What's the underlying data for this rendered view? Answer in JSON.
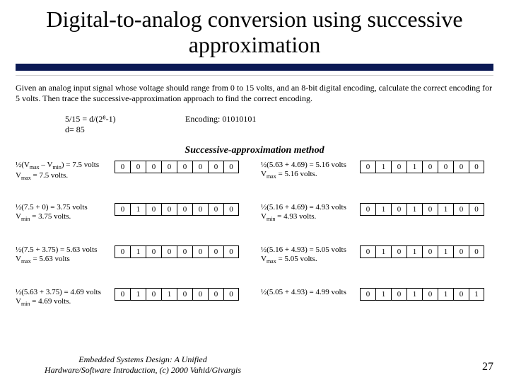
{
  "title": "Digital-to-analog conversion using successive approximation",
  "problem": "Given an analog input signal whose voltage should range from 0 to 15 volts, and an 8-bit digital encoding, calculate the correct encoding for 5 volts. Then trace the successive-approximation approach to find the correct encoding.",
  "setup": {
    "line1": "5/15 = d/(2⁸-1)",
    "line2": "d= 85",
    "encoding_label": "Encoding: 01010101"
  },
  "method_title": "Successive-approximation method",
  "left_steps": [
    {
      "l1": "½(V<max> – V<min>) = 7.5 volts",
      "l2": "V<max> = 7.5 volts.",
      "bits": [
        "0",
        "0",
        "0",
        "0",
        "0",
        "0",
        "0",
        "0"
      ]
    },
    {
      "l1": "½(7.5 + 0) = 3.75 volts",
      "l2": "V<min> = 3.75 volts.",
      "bits": [
        "0",
        "1",
        "0",
        "0",
        "0",
        "0",
        "0",
        "0"
      ]
    },
    {
      "l1": "½(7.5 + 3.75) = 5.63 volts",
      "l2": "V<max> = 5.63 volts",
      "bits": [
        "0",
        "1",
        "0",
        "0",
        "0",
        "0",
        "0",
        "0"
      ]
    },
    {
      "l1": "½(5.63 + 3.75) = 4.69 volts",
      "l2": "V<min> = 4.69 volts.",
      "bits": [
        "0",
        "1",
        "0",
        "1",
        "0",
        "0",
        "0",
        "0"
      ]
    }
  ],
  "right_steps": [
    {
      "l1": "½(5.63 + 4.69) = 5.16 volts",
      "l2": "V<max> = 5.16 volts.",
      "bits": [
        "0",
        "1",
        "0",
        "1",
        "0",
        "0",
        "0",
        "0"
      ]
    },
    {
      "l1": "½(5.16 + 4.69) = 4.93 volts",
      "l2": "V<min> = 4.93 volts.",
      "bits": [
        "0",
        "1",
        "0",
        "1",
        "0",
        "1",
        "0",
        "0"
      ]
    },
    {
      "l1": "½(5.16 + 4.93) = 5.05 volts",
      "l2": "V<max> = 5.05 volts.",
      "bits": [
        "0",
        "1",
        "0",
        "1",
        "0",
        "1",
        "0",
        "0"
      ]
    },
    {
      "l1": "½(5.05 + 4.93) = 4.99 volts",
      "l2": "",
      "bits": [
        "0",
        "1",
        "0",
        "1",
        "0",
        "1",
        "0",
        "1"
      ]
    }
  ],
  "footer": {
    "line1": "Embedded Systems Design: A Unified",
    "line2": "Hardware/Software Introduction, (c) 2000 Vahid/Givargis"
  },
  "page_number": "27"
}
